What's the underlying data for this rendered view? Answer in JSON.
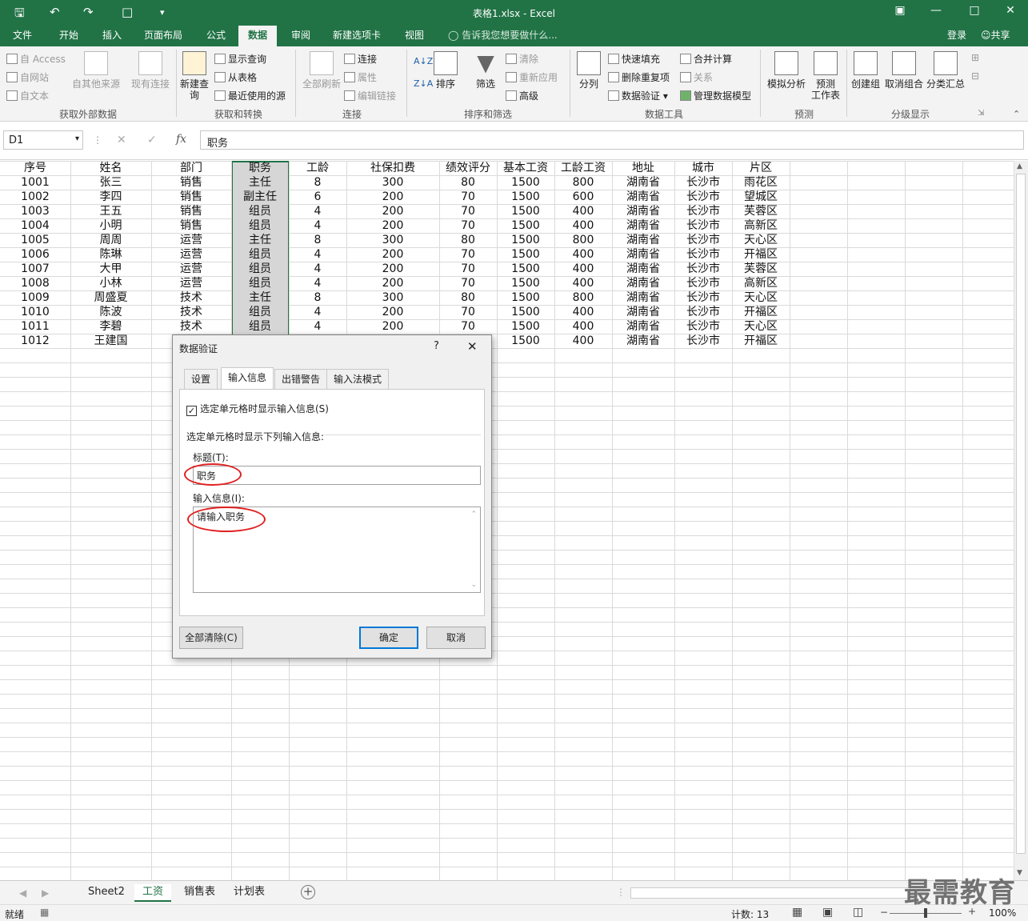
{
  "window": {
    "title": "表格1.xlsx - Excel",
    "login": "登录",
    "share": "共享"
  },
  "tabs": [
    "文件",
    "开始",
    "插入",
    "页面布局",
    "公式",
    "数据",
    "审阅",
    "新建选项卡",
    "视图"
  ],
  "tell_me": "告诉我您想要做什么...",
  "ribbon": {
    "get_external": {
      "access": "自 Access",
      "web": "自网站",
      "text": "自文本",
      "other": "自其他来源",
      "existing": "现有连接",
      "label": "获取外部数据"
    },
    "get_transform": {
      "new_query": "新建查询",
      "show_query": "显示查询",
      "from_table": "从表格",
      "recent": "最近使用的源",
      "label": "获取和转换"
    },
    "connections": {
      "refresh_all": "全部刷新",
      "connections": "连接",
      "properties": "属性",
      "edit_links": "编辑链接",
      "label": "连接"
    },
    "sort_filter": {
      "sort": "排序",
      "filter": "筛选",
      "clear": "清除",
      "reapply": "重新应用",
      "advanced": "高级",
      "label": "排序和筛选"
    },
    "data_tools": {
      "text_to_columns": "分列",
      "flash_fill": "快速填充",
      "remove_dup": "删除重复项",
      "validation": "数据验证",
      "consolidate": "合并计算",
      "relationships": "关系",
      "manage_model": "管理数据模型",
      "label": "数据工具"
    },
    "forecast": {
      "what_if": "模拟分析",
      "forecast_sheet_1": "预测",
      "forecast_sheet_2": "工作表",
      "label": "预测"
    },
    "outline": {
      "group": "创建组",
      "ungroup": "取消组合",
      "subtotal": "分类汇总",
      "label": "分级显示"
    }
  },
  "formula_bar": {
    "name_box": "D1",
    "content": "职务"
  },
  "sheet": {
    "headers": [
      "序号",
      "姓名",
      "部门",
      "职务",
      "工龄",
      "社保扣费",
      "绩效评分",
      "基本工资",
      "工龄工资",
      "地址",
      "城市",
      "片区"
    ],
    "rows": [
      [
        "1001",
        "张三",
        "销售",
        "主任",
        "8",
        "300",
        "80",
        "1500",
        "800",
        "湖南省",
        "长沙市",
        "雨花区"
      ],
      [
        "1002",
        "李四",
        "销售",
        "副主任",
        "6",
        "200",
        "70",
        "1500",
        "600",
        "湖南省",
        "长沙市",
        "望城区"
      ],
      [
        "1003",
        "王五",
        "销售",
        "组员",
        "4",
        "200",
        "70",
        "1500",
        "400",
        "湖南省",
        "长沙市",
        "芙蓉区"
      ],
      [
        "1004",
        "小明",
        "销售",
        "组员",
        "4",
        "200",
        "70",
        "1500",
        "400",
        "湖南省",
        "长沙市",
        "高新区"
      ],
      [
        "1005",
        "周周",
        "运营",
        "主任",
        "8",
        "300",
        "80",
        "1500",
        "800",
        "湖南省",
        "长沙市",
        "天心区"
      ],
      [
        "1006",
        "陈琳",
        "运营",
        "组员",
        "4",
        "200",
        "70",
        "1500",
        "400",
        "湖南省",
        "长沙市",
        "开福区"
      ],
      [
        "1007",
        "大甲",
        "运营",
        "组员",
        "4",
        "200",
        "70",
        "1500",
        "400",
        "湖南省",
        "长沙市",
        "芙蓉区"
      ],
      [
        "1008",
        "小林",
        "运营",
        "组员",
        "4",
        "200",
        "70",
        "1500",
        "400",
        "湖南省",
        "长沙市",
        "高新区"
      ],
      [
        "1009",
        "周盛夏",
        "技术",
        "主任",
        "8",
        "300",
        "80",
        "1500",
        "800",
        "湖南省",
        "长沙市",
        "天心区"
      ],
      [
        "1010",
        "陈波",
        "技术",
        "组员",
        "4",
        "200",
        "70",
        "1500",
        "400",
        "湖南省",
        "长沙市",
        "开福区"
      ],
      [
        "1011",
        "李碧",
        "技术",
        "组员",
        "4",
        "200",
        "70",
        "1500",
        "400",
        "湖南省",
        "长沙市",
        "天心区"
      ],
      [
        "1012",
        "王建国",
        "",
        "",
        "",
        "",
        "",
        "1500",
        "400",
        "湖南省",
        "长沙市",
        "开福区"
      ]
    ]
  },
  "sheet_tabs": [
    "Sheet2",
    "工资",
    "销售表",
    "计划表"
  ],
  "status": {
    "ready": "就绪",
    "count": "计数: 13",
    "zoom": "100%"
  },
  "dialog": {
    "title": "数据验证",
    "help": "?",
    "tabs": [
      "设置",
      "输入信息",
      "出错警告",
      "输入法模式"
    ],
    "checkbox_label": "选定单元格时显示输入信息(S)",
    "section_label": "选定单元格时显示下列输入信息:",
    "title_label": "标题(T):",
    "title_value": "职务",
    "message_label": "输入信息(I):",
    "message_value": "请输入职务",
    "clear_all": "全部清除(C)",
    "ok": "确定",
    "cancel": "取消"
  },
  "watermark": "最需教育"
}
